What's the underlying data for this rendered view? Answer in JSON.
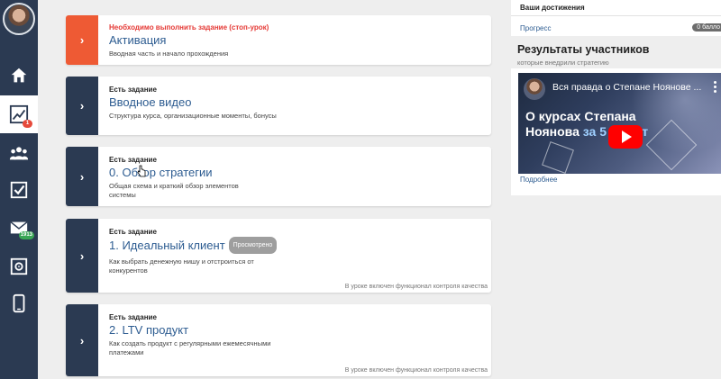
{
  "sidebar": {
    "nav_badges": {
      "progress": "1",
      "messages": "1913"
    }
  },
  "lessons": [
    {
      "requirement": "Необходимо выполнить задание (стоп-урок)",
      "title": "Активация",
      "description": "Вводная часть и начало прохождения",
      "chevron": "›"
    },
    {
      "requirement": "Есть задание",
      "title": "Вводное видео",
      "description": "Структура курса, организационные моменты, бонусы",
      "chevron": "›"
    },
    {
      "requirement": "Есть задание",
      "title": "0. Обзор стратегии",
      "description": "Общая схема и краткий обзор элементов системы",
      "chevron": "›"
    },
    {
      "requirement": "Есть задание",
      "title": "1. Идеальный клиент",
      "status": "Просмотрено",
      "description": "Как выбрать денежную нишу и отстроиться от конкурентов",
      "quality_note": "В уроке включен функционал контроля качества",
      "chevron": "›"
    },
    {
      "requirement": "Есть задание",
      "title": "2. LTV продукт",
      "description": "Как создать продукт с регулярными ежемесячными платежами",
      "quality_note": "В уроке включен функционал контроля качества",
      "chevron": "›"
    }
  ],
  "achievements": {
    "title": "Ваши достижения",
    "progress_label": "Прогресс",
    "points": "0 балло"
  },
  "results": {
    "title": "Результаты участников",
    "subtitle": "которые внедрили стратегию",
    "video": {
      "title": "Вся правда о Степане Ноянове ...",
      "overlay_line1": "О курсах Степана",
      "overlay_line2_a": "Ноянова ",
      "overlay_line2_b": "за 5 минут"
    },
    "link": "Подробнее"
  },
  "colors": {
    "sidebar": "#2b3a52",
    "stop_lesson": "#ee5a34",
    "title_blue": "#2d5c91",
    "badge_red": "#e64a3b",
    "badge_green": "#3aa655",
    "youtube_red": "#ff0000"
  }
}
